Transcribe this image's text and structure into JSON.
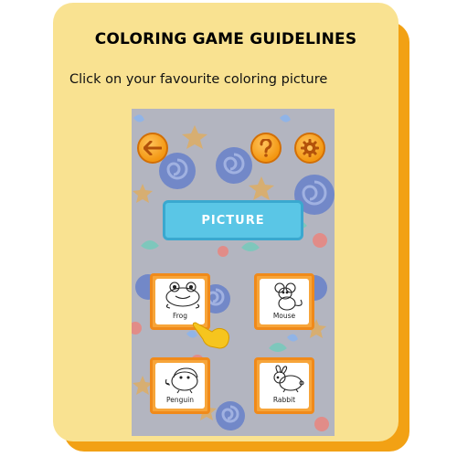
{
  "title": "COLORING GAME GUIDELINES",
  "instruction": "Click on your favourite coloring picture",
  "game": {
    "picture_label": "PICTURE",
    "back_icon": "arrow-left-icon",
    "help_icon": "question-mark-icon",
    "settings_icon": "gear-icon",
    "pictures": [
      {
        "label": "Frog",
        "icon": "frog-icon"
      },
      {
        "label": "Mouse",
        "icon": "mouse-icon"
      },
      {
        "label": "Penguin",
        "icon": "penguin-icon"
      },
      {
        "label": "Rabbit",
        "icon": "rabbit-icon"
      }
    ]
  },
  "colors": {
    "card": "#f9e291",
    "card_shadow": "#f2a114",
    "button_orange": "#f39712",
    "picture_button": "#5ac6e6",
    "phone_background": "#b3b5c0"
  }
}
